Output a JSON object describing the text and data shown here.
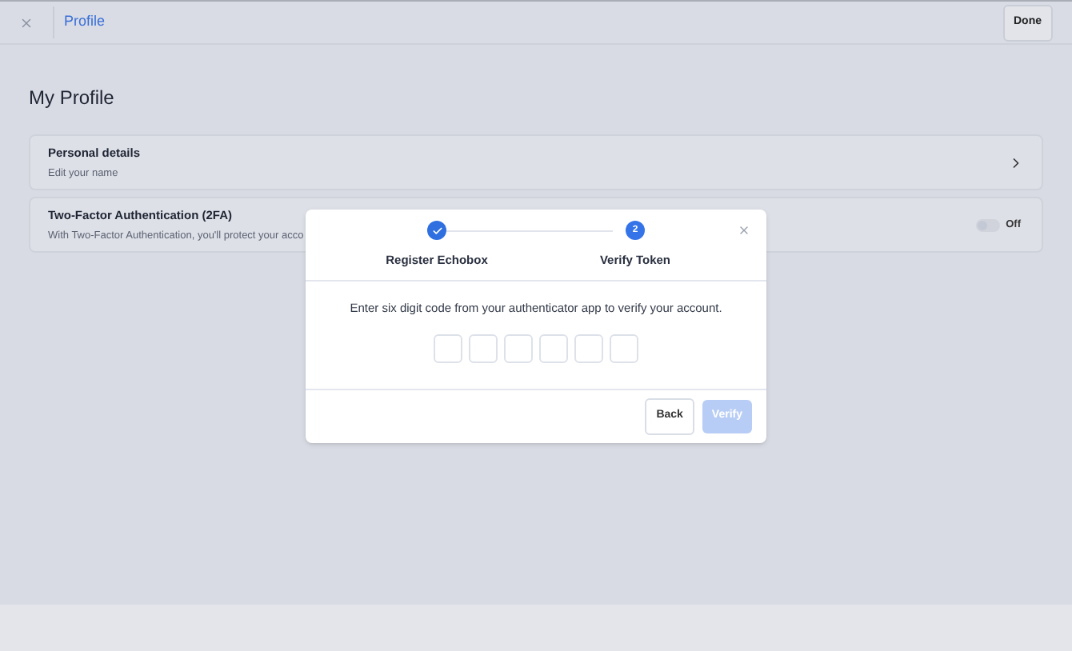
{
  "header": {
    "title": "Profile",
    "done_button": "Done"
  },
  "page_title": "My Profile",
  "cards": [
    {
      "kind": "link",
      "title": "Personal details",
      "subtitle": "Edit your name"
    },
    {
      "kind": "toggle",
      "title": "Two-Factor Authentication (2FA)",
      "subtitle": "With Two-Factor Authentication, you'll protect your acco",
      "on": false,
      "toggle_label": "Off"
    }
  ],
  "dialog": {
    "steps": [
      {
        "label": "Register Echobox",
        "completed": true
      },
      {
        "label": "Verify Token",
        "completed": false,
        "number": "2"
      }
    ],
    "instruction": "Enter six digit code from your authenticator app to verify your account.",
    "code_fields": [
      {
        "filled": false
      },
      {
        "filled": false
      },
      {
        "filled": false
      },
      {
        "filled": false
      },
      {
        "filled": false
      },
      {
        "filled": false
      }
    ],
    "back_button": "Back",
    "verify_button": {
      "label": "Verify",
      "disabled": true
    }
  }
}
